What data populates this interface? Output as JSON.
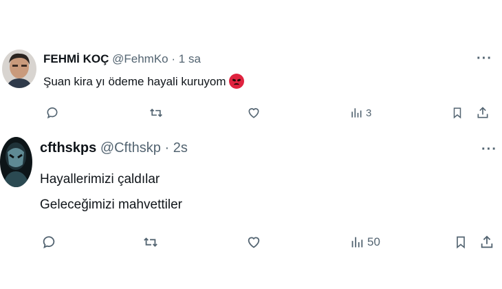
{
  "tweets": [
    {
      "name": "FEHMİ KOÇ",
      "handle": "@FehmKo",
      "separator": "·",
      "time": "1 sa",
      "text": "Şuan kira yı ödeme hayali kuruyom",
      "emoji": "angry-face-icon",
      "views": "3"
    },
    {
      "name": "cfthskps",
      "handle": "@Cfthskp",
      "separator": "·",
      "time": "2s",
      "lines": [
        "Hayallerimizi çaldılar",
        "Geleceğimizi mahvettiler"
      ],
      "views": "50"
    }
  ],
  "colors": {
    "text": "#0f1419",
    "secondary": "#536471",
    "emoji": "#e0233f",
    "background": "#ffffff"
  },
  "icons": [
    "more-icon",
    "reply-icon",
    "retweet-icon",
    "like-icon",
    "views-icon",
    "bookmark-icon",
    "share-icon"
  ]
}
